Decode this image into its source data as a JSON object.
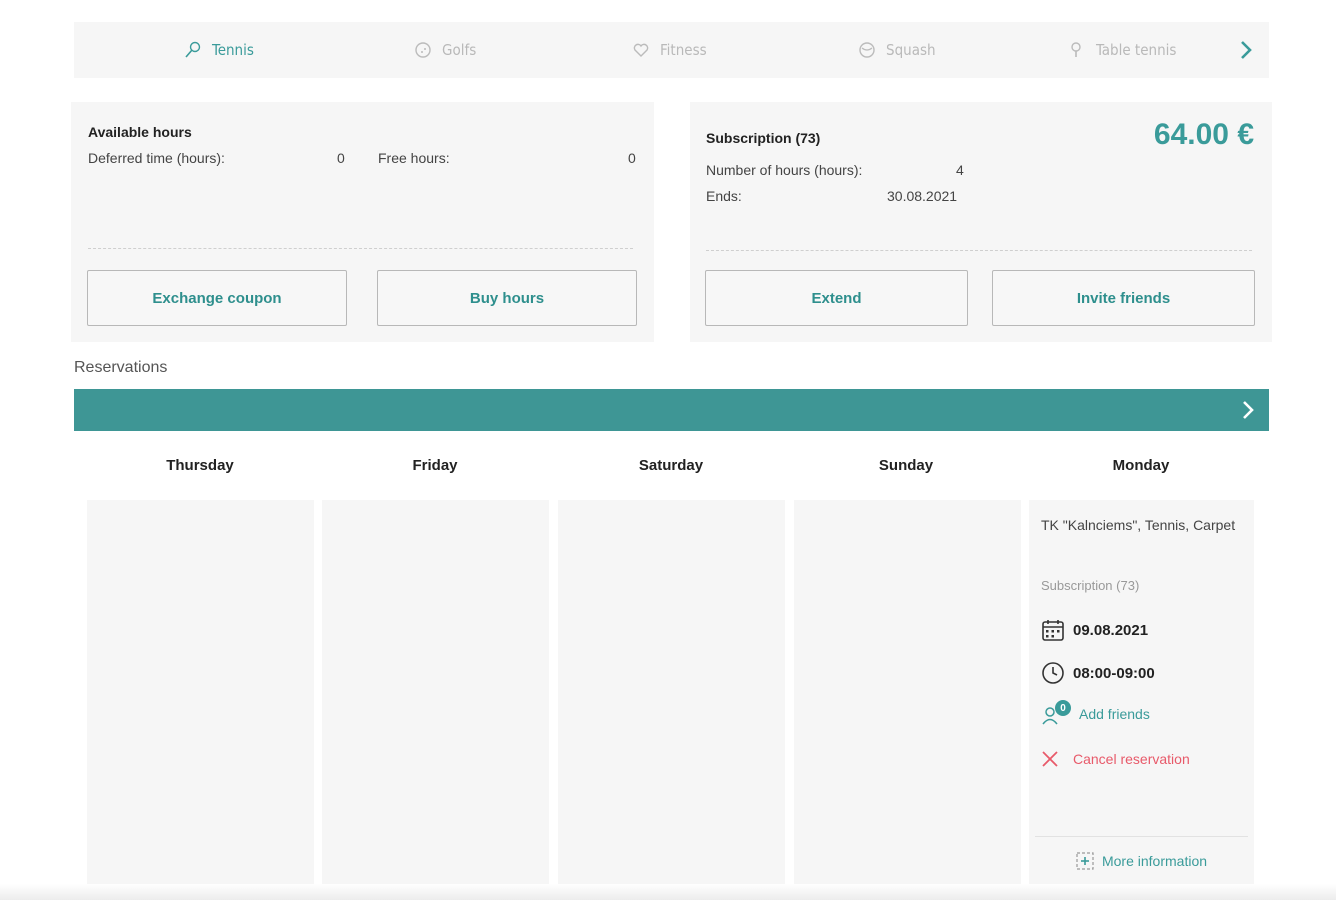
{
  "sports": [
    {
      "label": "Tennis",
      "icon": "tennis-racket-icon",
      "active": true
    },
    {
      "label": "Golfs",
      "icon": "golf-ball-icon",
      "active": false
    },
    {
      "label": "Fitness",
      "icon": "heart-icon",
      "active": false
    },
    {
      "label": "Squash",
      "icon": "squash-ball-icon",
      "active": false
    },
    {
      "label": "Table tennis",
      "icon": "table-tennis-icon",
      "active": false
    }
  ],
  "available": {
    "title": "Available hours",
    "deferred_label": "Deferred time (hours):",
    "deferred_value": "0",
    "free_label": "Free hours:",
    "free_value": "0",
    "exchange_button": "Exchange coupon",
    "buy_button": "Buy hours"
  },
  "subscription": {
    "title": "Subscription (73)",
    "price": "64.00 €",
    "hours_label": "Number of hours (hours):",
    "hours_value": "4",
    "ends_label": "Ends:",
    "ends_value": "30.08.2021",
    "extend_button": "Extend",
    "invite_button": "Invite friends"
  },
  "reservations": {
    "title": "Reservations",
    "days": [
      "Thursday",
      "Friday",
      "Saturday",
      "Sunday",
      "Monday"
    ],
    "booking": {
      "venue": "TK \"Kalnciems\", Tennis, Carpet",
      "subscription": "Subscription (73)",
      "date": "09.08.2021",
      "time": "08:00-09:00",
      "friends_badge": "0",
      "add_friends": "Add friends",
      "cancel": "Cancel reservation",
      "more": "More information"
    }
  },
  "colors": {
    "accent": "#3e9695",
    "danger": "#e85a6a",
    "panel": "#f6f6f6"
  }
}
